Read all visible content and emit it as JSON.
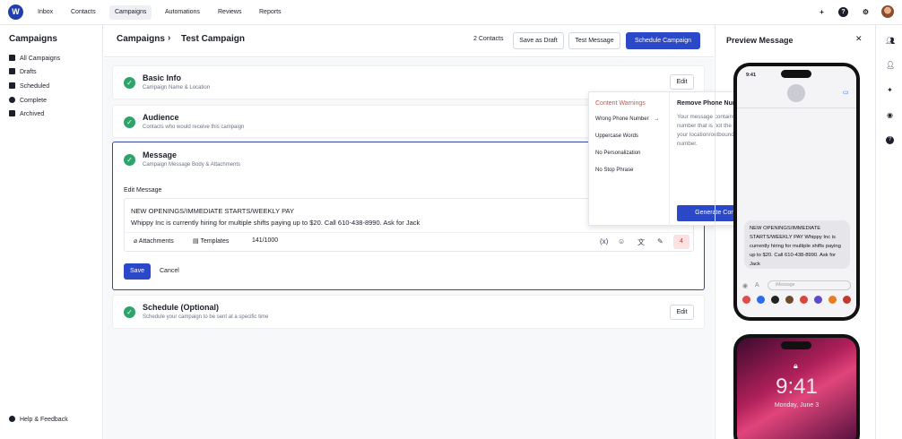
{
  "nav": {
    "items": [
      "Inbox",
      "Contacts",
      "Campaigns",
      "Automations",
      "Reviews",
      "Reports"
    ],
    "active": "Campaigns"
  },
  "sidebar": {
    "title": "Campaigns",
    "items": [
      {
        "label": "All Campaigns",
        "icon": "megaphone-icon"
      },
      {
        "label": "Drafts",
        "icon": "document-icon"
      },
      {
        "label": "Scheduled",
        "icon": "calendar-icon"
      },
      {
        "label": "Complete",
        "icon": "check-circle-icon"
      },
      {
        "label": "Archived",
        "icon": "archive-icon"
      }
    ],
    "help": "Help & Feedback"
  },
  "header": {
    "title": "Campaigns",
    "subtitle": "Test Campaign",
    "contacts": "2 Contacts",
    "save_draft": "Save as Draft",
    "test_message": "Test Message",
    "schedule": "Schedule Campaign"
  },
  "sections": {
    "basic": {
      "title": "Basic Info",
      "sub": "Campaign Name & Location",
      "edit": "Edit"
    },
    "audience": {
      "title": "Audience",
      "sub": "Contacts who would receive this campaign"
    },
    "message": {
      "title": "Message",
      "sub": "Campaign Message Body & Attachments",
      "edit_label": "Edit Message",
      "line1": "NEW OPENINGS/IMMEDIATE STARTS/WEEKLY PAY",
      "line2": "Whippy Inc is currently hiring for multiple shifts paying up to $20. Call 610-438-8990. Ask for Jack",
      "attachments": "Attachments",
      "templates": "Templates",
      "counter": "141/1000",
      "warning_count": "4",
      "save": "Save",
      "cancel": "Cancel"
    },
    "schedule": {
      "title": "Schedule (Optional)",
      "sub": "Schedule your campaign to be sent at a specific time",
      "edit": "Edit"
    }
  },
  "warnings": {
    "heading": "Content Warnings",
    "items": [
      "Wrong Phone Number",
      "Uppercase Words",
      "No Personalization",
      "No Stop Phrase"
    ],
    "detail_title": "Remove Phone Number",
    "detail_text": "Your message contains a phone number that is not the same as your location/outbound phone number.",
    "generate": "Generate Content"
  },
  "preview": {
    "title": "Preview Message",
    "time": "9:41",
    "bubble": "NEW OPENINGS/IMMEDIATE STARTS/WEEKLY PAY Whippy Inc is currently hiring for multiple shifts paying up to $20. Call 610-438-8990. Ask for Jack",
    "input_placeholder": "iMessage",
    "lock_time": "9:41",
    "lock_date": "Monday, June 3"
  },
  "colors": {
    "primary": "#2a48c8",
    "success": "#2ea36b",
    "warning": "#c2594a"
  }
}
